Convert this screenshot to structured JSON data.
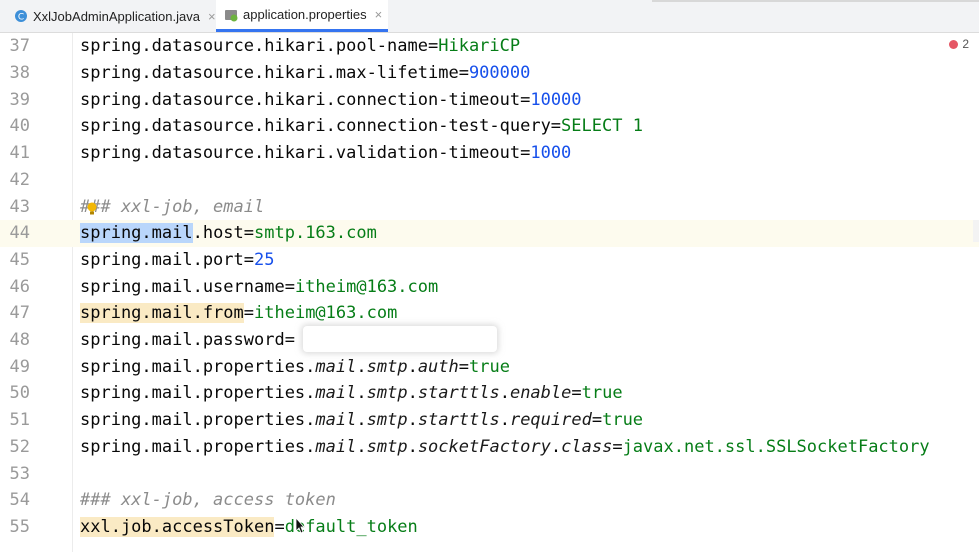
{
  "tabs": [
    {
      "label": "XxlJobAdminApplication.java",
      "close": "×"
    },
    {
      "label": "application.properties",
      "close": "×"
    }
  ],
  "problems": {
    "count": "2"
  },
  "lines": [
    {
      "n": "37",
      "parts": [
        [
          "k",
          "spring.datasource.hikari.pool-name="
        ],
        [
          "v",
          "HikariCP"
        ]
      ]
    },
    {
      "n": "38",
      "parts": [
        [
          "k",
          "spring.datasource.hikari.max-lifetime="
        ],
        [
          "num",
          "900000"
        ]
      ]
    },
    {
      "n": "39",
      "parts": [
        [
          "k",
          "spring.datasource.hikari.connection-timeout="
        ],
        [
          "num",
          "10000"
        ]
      ]
    },
    {
      "n": "40",
      "parts": [
        [
          "k",
          "spring.datasource.hikari.connection-test-query="
        ],
        [
          "v",
          "SELECT 1"
        ]
      ]
    },
    {
      "n": "41",
      "parts": [
        [
          "k",
          "spring.datasource.hikari.validation-timeout="
        ],
        [
          "num",
          "1000"
        ]
      ]
    },
    {
      "n": "42",
      "parts": []
    },
    {
      "n": "43",
      "parts": [
        [
          "cm",
          "### xxl-job, email"
        ]
      ]
    },
    {
      "n": "44",
      "parts": [
        [
          "sel",
          "spring.mail"
        ],
        [
          "k",
          ".host="
        ],
        [
          "v",
          "smtp.163.com"
        ]
      ],
      "hl": true
    },
    {
      "n": "45",
      "parts": [
        [
          "k",
          "spring.mail.port="
        ],
        [
          "num",
          "25"
        ]
      ]
    },
    {
      "n": "46",
      "parts": [
        [
          "k",
          "spring.mail.username="
        ],
        [
          "v",
          "itheim@163.com"
        ]
      ]
    },
    {
      "n": "47",
      "parts": [
        [
          "yel",
          "spring.mail.from"
        ],
        [
          "k",
          "="
        ],
        [
          "v",
          "itheim@163.com"
        ]
      ]
    },
    {
      "n": "48",
      "parts": [
        [
          "k",
          "spring.mail.password="
        ]
      ]
    },
    {
      "n": "49",
      "parts": [
        [
          "k",
          "spring.mail.properties."
        ],
        [
          "it",
          "mail"
        ],
        [
          "k",
          "."
        ],
        [
          "it",
          "smtp"
        ],
        [
          "k",
          "."
        ],
        [
          "it",
          "auth"
        ],
        [
          "k",
          "="
        ],
        [
          "v",
          "true"
        ]
      ]
    },
    {
      "n": "50",
      "parts": [
        [
          "k",
          "spring.mail.properties."
        ],
        [
          "it",
          "mail"
        ],
        [
          "k",
          "."
        ],
        [
          "it",
          "smtp"
        ],
        [
          "k",
          "."
        ],
        [
          "it",
          "starttls"
        ],
        [
          "k",
          "."
        ],
        [
          "it",
          "enable"
        ],
        [
          "k",
          "="
        ],
        [
          "v",
          "true"
        ]
      ]
    },
    {
      "n": "51",
      "parts": [
        [
          "k",
          "spring.mail.properties."
        ],
        [
          "it",
          "mail"
        ],
        [
          "k",
          "."
        ],
        [
          "it",
          "smtp"
        ],
        [
          "k",
          "."
        ],
        [
          "it",
          "starttls"
        ],
        [
          "k",
          "."
        ],
        [
          "it",
          "required"
        ],
        [
          "k",
          "="
        ],
        [
          "v",
          "true"
        ]
      ]
    },
    {
      "n": "52",
      "parts": [
        [
          "k",
          "spring.mail.properties."
        ],
        [
          "it",
          "mail"
        ],
        [
          "k",
          "."
        ],
        [
          "it",
          "smtp"
        ],
        [
          "k",
          "."
        ],
        [
          "it",
          "socketFactory"
        ],
        [
          "k",
          "."
        ],
        [
          "it",
          "class"
        ],
        [
          "k",
          "="
        ],
        [
          "v",
          "javax.net.ssl.SSLSocketFactory"
        ]
      ]
    },
    {
      "n": "53",
      "parts": []
    },
    {
      "n": "54",
      "parts": [
        [
          "cm",
          "### xxl-job, access token"
        ]
      ]
    },
    {
      "n": "55",
      "parts": [
        [
          "yel",
          "xxl.job.accessToken"
        ],
        [
          "k",
          "="
        ],
        [
          "v",
          "default_token"
        ]
      ]
    }
  ],
  "colors": {
    "accent": "#3574f0",
    "value": "#067d17",
    "number": "#1750eb",
    "comment": "#8c8c8c"
  }
}
